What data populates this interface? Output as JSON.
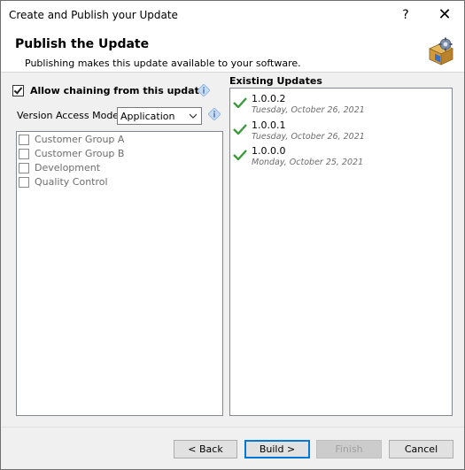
{
  "window": {
    "title": "Create and Publish your Update",
    "help_glyph": "?",
    "close_glyph": "✕"
  },
  "header": {
    "title": "Publish the Update",
    "subtitle": "Publishing makes this update available to your software."
  },
  "chaining": {
    "label": "Allow chaining from this update",
    "checked": true
  },
  "version_access": {
    "label": "Version Access Mode:",
    "selected": "Application"
  },
  "customer_groups": [
    {
      "label": "Customer Group A",
      "checked": false
    },
    {
      "label": "Customer Group B",
      "checked": false
    },
    {
      "label": "Development",
      "checked": false
    },
    {
      "label": "Quality Control",
      "checked": false
    }
  ],
  "existing_updates": {
    "label": "Existing Updates",
    "items": [
      {
        "version": "1.0.0.2",
        "date": "Tuesday, October 26, 2021"
      },
      {
        "version": "1.0.0.1",
        "date": "Tuesday, October 26, 2021"
      },
      {
        "version": "1.0.0.0",
        "date": "Monday, October 25, 2021"
      }
    ]
  },
  "buttons": {
    "back": "< Back",
    "build": "Build >",
    "finish": "Finish",
    "cancel": "Cancel"
  },
  "colors": {
    "check_green": "#3c9a3c",
    "info_blue": "#a9c6e8",
    "accent_blue": "#0078d7"
  }
}
